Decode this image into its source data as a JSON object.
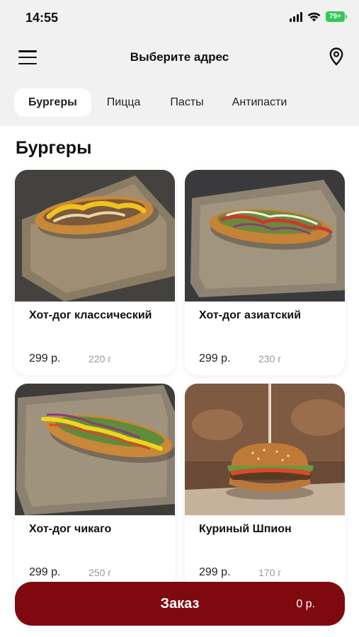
{
  "status_bar": {
    "time": "14:55",
    "battery": "79+"
  },
  "header": {
    "title": "Выберите адрес"
  },
  "tabs": [
    {
      "label": "Бургеры",
      "active": true
    },
    {
      "label": "Пицца",
      "active": false
    },
    {
      "label": "Пасты",
      "active": false
    },
    {
      "label": "Антипасти",
      "active": false
    }
  ],
  "section": {
    "title": "Бургеры"
  },
  "products": [
    {
      "name": "Хот-дог классический",
      "price": "299 р.",
      "weight": "220 г",
      "icon": "hotdog-image"
    },
    {
      "name": "Хот-дог азиатский",
      "price": "299 р.",
      "weight": "230 г",
      "icon": "hotdog-image"
    },
    {
      "name": "Хот-дог чикаго",
      "price": "299 р.",
      "weight": "250 г",
      "icon": "hotdog-image"
    },
    {
      "name": "Куриный Шпион",
      "price": "299 р.",
      "weight": "170 г",
      "icon": "burger-image"
    }
  ],
  "order": {
    "label": "Заказ",
    "sum": "0 р."
  },
  "colors": {
    "accent": "#7e0a10",
    "header_bg": "#f1f1f1",
    "battery": "#34c759"
  }
}
